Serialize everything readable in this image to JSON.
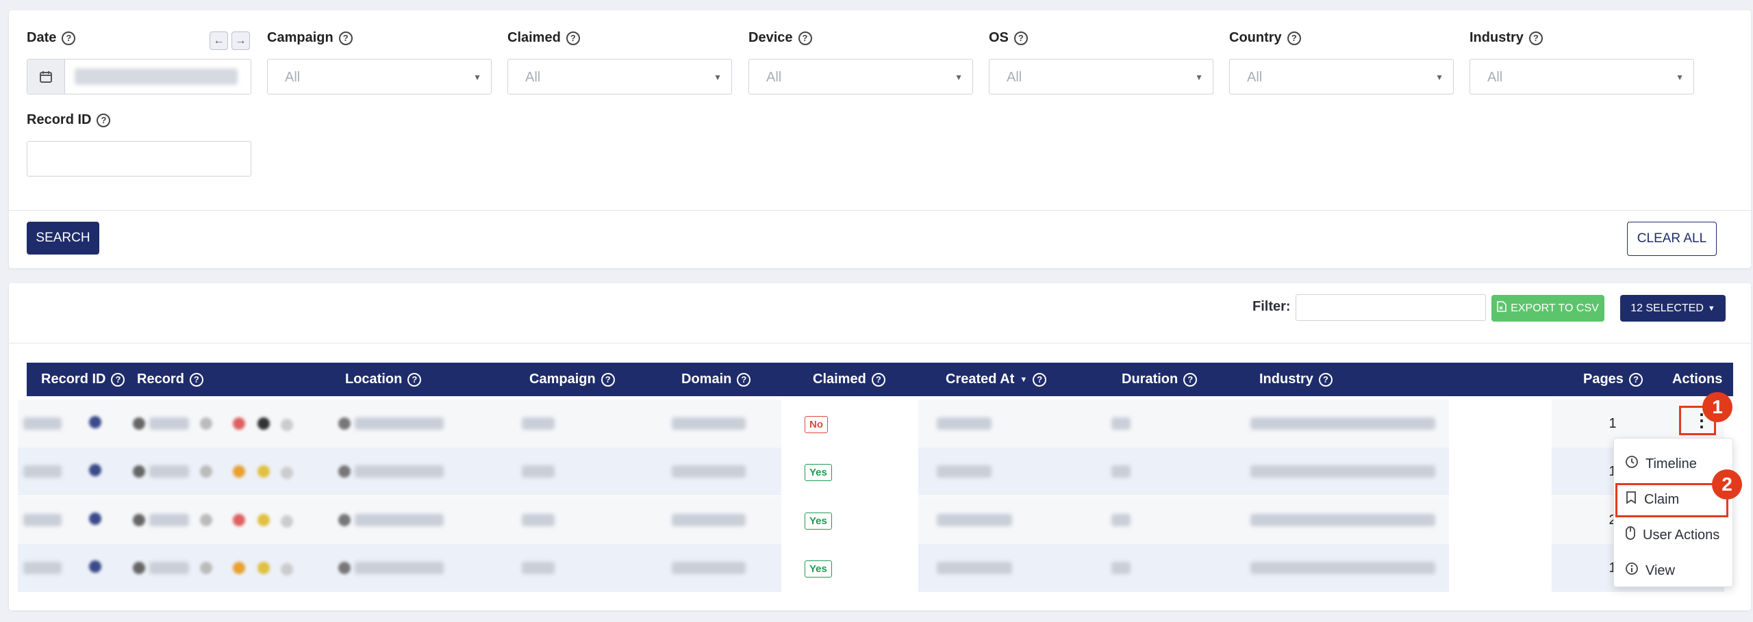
{
  "filters": {
    "date": {
      "label": "Date"
    },
    "campaign": {
      "label": "Campaign",
      "value": "All"
    },
    "claimed": {
      "label": "Claimed",
      "value": "All"
    },
    "device": {
      "label": "Device",
      "value": "All"
    },
    "os": {
      "label": "OS",
      "value": "All"
    },
    "country": {
      "label": "Country",
      "value": "All"
    },
    "industry": {
      "label": "Industry",
      "value": "All"
    },
    "record_id": {
      "label": "Record ID",
      "value": ""
    },
    "search_label": "SEARCH",
    "clear_label": "CLEAR ALL"
  },
  "toolbar": {
    "filter_label": "Filter:",
    "filter_value": "",
    "export_label": "EXPORT TO CSV",
    "selected_label": "12 SELECTED"
  },
  "table": {
    "headers": {
      "record_id": "Record ID",
      "record": "Record",
      "location": "Location",
      "campaign": "Campaign",
      "domain": "Domain",
      "claimed": "Claimed",
      "created_at": "Created At",
      "duration": "Duration",
      "industry": "Industry",
      "pages": "Pages",
      "actions": "Actions"
    },
    "rows": [
      {
        "claimed": "No",
        "pages": "1"
      },
      {
        "claimed": "Yes",
        "pages": "1"
      },
      {
        "claimed": "Yes",
        "pages": "2"
      },
      {
        "claimed": "Yes",
        "pages": "1"
      }
    ]
  },
  "actions_menu": {
    "items": [
      {
        "label": "Timeline",
        "icon": "clock-icon"
      },
      {
        "label": "Claim",
        "icon": "bookmark-icon"
      },
      {
        "label": "User Actions",
        "icon": "mouse-icon"
      },
      {
        "label": "View",
        "icon": "info-icon"
      }
    ]
  },
  "annotations": {
    "one": "1",
    "two": "2"
  },
  "colors": {
    "primary": "#1f2c6b",
    "export_green": "#5cc46b",
    "annotation_red": "#e23b1c",
    "no_red": "#e0483a",
    "yes_green": "#1f9a56"
  }
}
